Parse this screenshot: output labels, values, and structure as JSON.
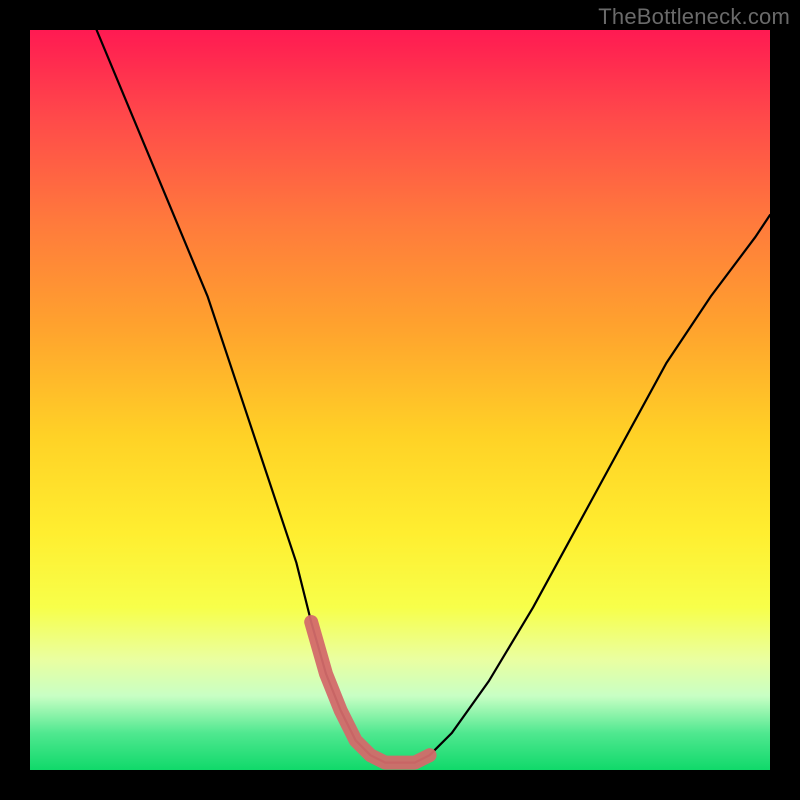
{
  "watermark": "TheBottleneck.com",
  "chart_data": {
    "type": "line",
    "title": "",
    "xlabel": "",
    "ylabel": "",
    "xlim": [
      0,
      100
    ],
    "ylim": [
      0,
      100
    ],
    "grid": false,
    "series": [
      {
        "name": "curve",
        "color": "#000000",
        "x": [
          9,
          14,
          19,
          24,
          28,
          32,
          36,
          38,
          40,
          42,
          44,
          46,
          48,
          50,
          52,
          54,
          57,
          62,
          68,
          74,
          80,
          86,
          92,
          98,
          100
        ],
        "y": [
          100,
          88,
          76,
          64,
          52,
          40,
          28,
          20,
          13,
          8,
          4,
          2,
          1,
          1,
          1,
          2,
          5,
          12,
          22,
          33,
          44,
          55,
          64,
          72,
          75
        ]
      },
      {
        "name": "highlight",
        "color": "#d36a6a",
        "x": [
          38,
          40,
          42,
          44,
          46,
          48,
          50,
          52,
          54
        ],
        "y": [
          20,
          13,
          8,
          4,
          2,
          1,
          1,
          1,
          2
        ]
      }
    ],
    "note": "Axes are unlabeled; values are rough estimates from pixel positions on a 0–100 normalized scale."
  }
}
